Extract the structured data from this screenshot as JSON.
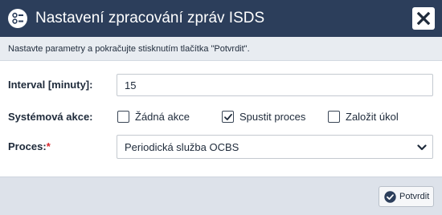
{
  "dialog": {
    "title": "Nastavení zpracování zpráv ISDS",
    "title_icon": "settings-list-icon",
    "close_icon": "close-icon",
    "info_text": "Nastavte parametry a pokračujte stisknutím tlačítka \"Potvrdit\"."
  },
  "form": {
    "interval": {
      "label": "Interval [minuty]:",
      "value": "15"
    },
    "system_action": {
      "label": "Systémová akce:",
      "options": [
        {
          "label": "Žádná akce",
          "checked": false
        },
        {
          "label": "Spustit proces",
          "checked": true
        },
        {
          "label": "Založit úkol",
          "checked": false
        }
      ]
    },
    "process": {
      "label": "Proces:",
      "required_mark": "*",
      "selected": "Periodická služba OCBS"
    }
  },
  "footer": {
    "confirm_label": "Potvrdit",
    "confirm_icon": "check-circle-icon"
  },
  "colors": {
    "titlebar": "#2c3e5b",
    "info_strip": "#e8ecf1",
    "footer": "#dde2ea",
    "required": "#d9262c"
  }
}
